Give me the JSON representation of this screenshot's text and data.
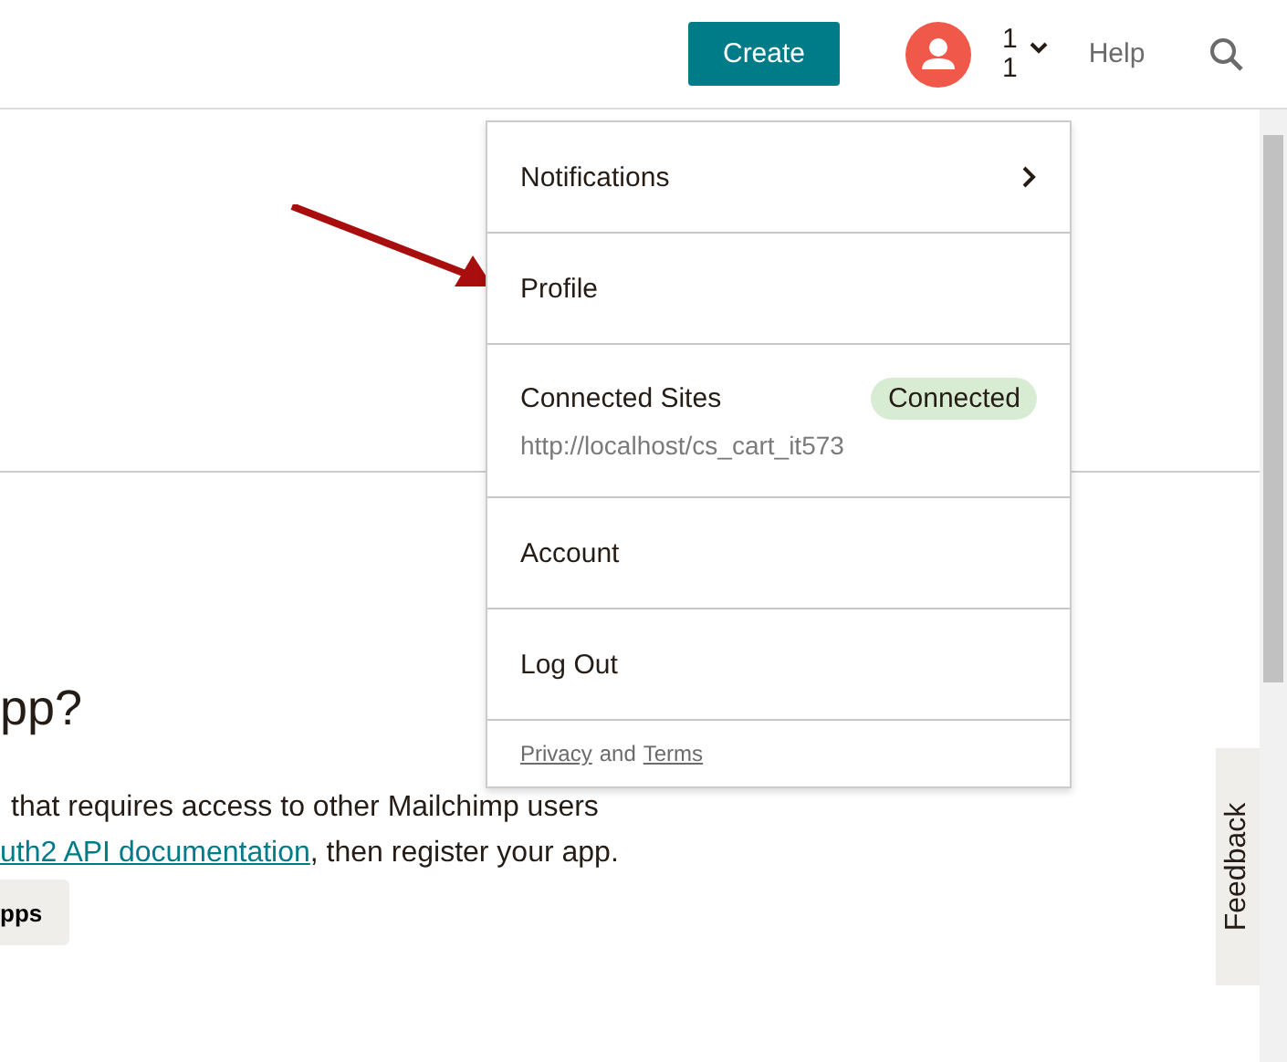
{
  "header": {
    "create_button": "Create",
    "account_lines": [
      "1",
      "1"
    ],
    "help_link": "Help"
  },
  "page": {
    "heading": "pp?",
    "paragraph": {
      "line_1": "that requires access to other Mailchimp users",
      "link": "uth2 API documentation",
      "line_2_rest": ", then register your app."
    },
    "button": "pps"
  },
  "menu": {
    "items": [
      {
        "kind": "submenu",
        "label": "Notifications"
      },
      {
        "kind": "plain",
        "label": "Profile"
      },
      {
        "kind": "site",
        "label": "Connected Sites",
        "badge": "Connected",
        "url": "http://localhost/cs_cart_it573"
      },
      {
        "kind": "plain",
        "label": "Account"
      },
      {
        "kind": "plain",
        "label": "Log Out"
      }
    ],
    "footer": {
      "privacy": "Privacy",
      "and": "and",
      "terms": "Terms"
    }
  },
  "feedback_tab": "Feedback"
}
